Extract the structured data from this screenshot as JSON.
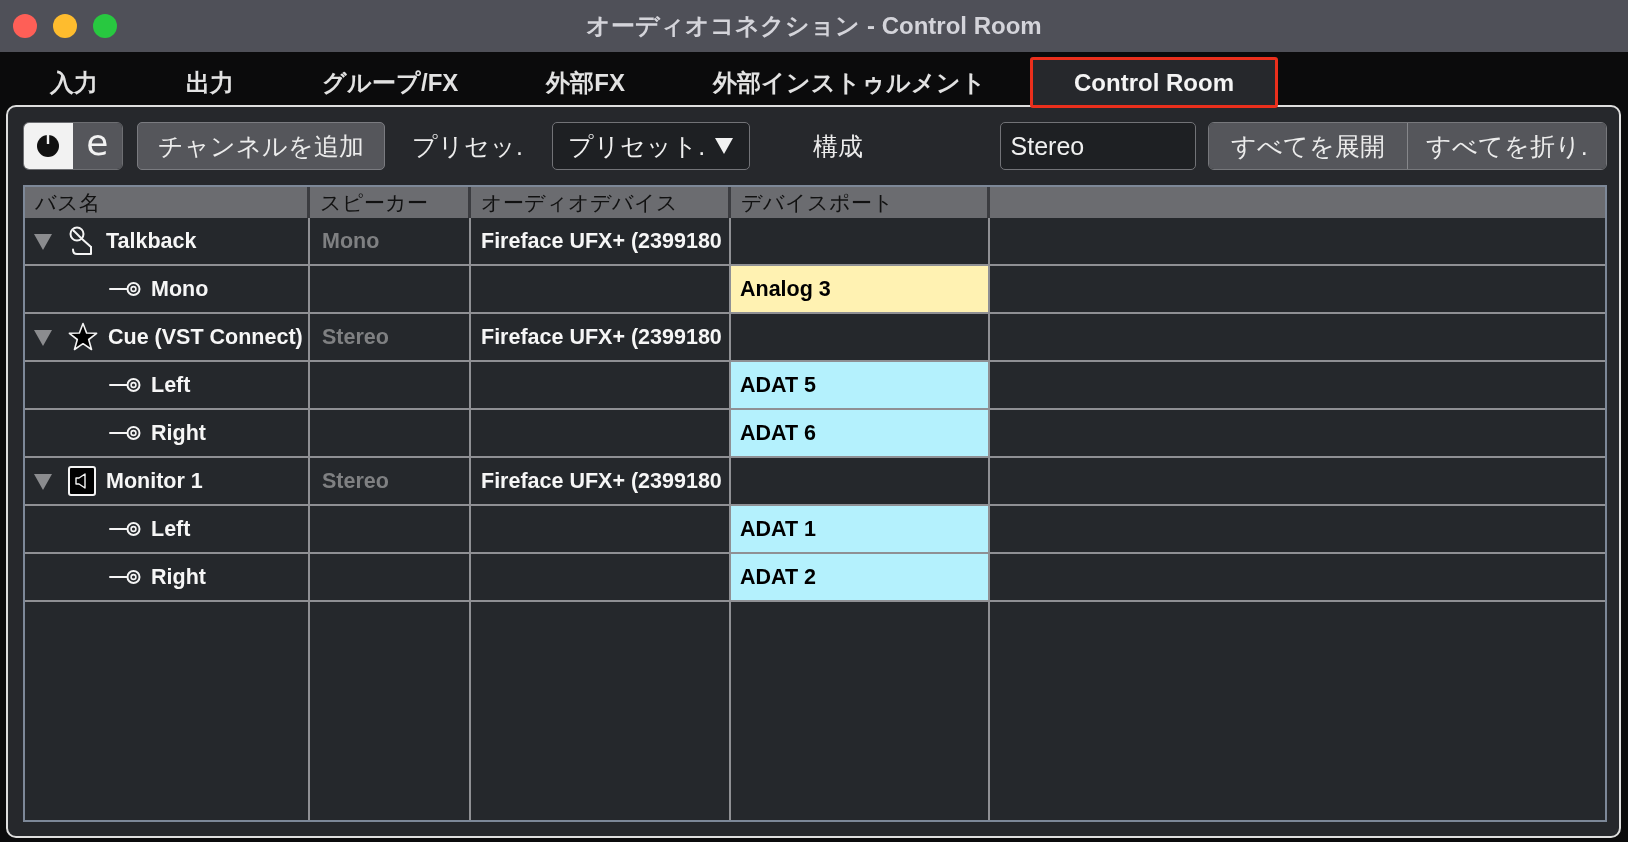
{
  "window": {
    "title": "オーディオコネクション - Control Room"
  },
  "tabs": [
    {
      "label": "入力",
      "selected": false,
      "highlighted": false
    },
    {
      "label": "出力",
      "selected": false,
      "highlighted": false
    },
    {
      "label": "グループ/FX",
      "selected": false,
      "highlighted": false
    },
    {
      "label": "外部FX",
      "selected": false,
      "highlighted": false
    },
    {
      "label": "外部インストゥルメント",
      "selected": false,
      "highlighted": false
    },
    {
      "label": "Control Room",
      "selected": true,
      "highlighted": true
    }
  ],
  "toolbar": {
    "toggles": [
      {
        "kind": "power",
        "on": true
      },
      {
        "kind": "edit",
        "label": "e",
        "on": false
      }
    ],
    "add_channel": "チャンネルを追加",
    "preset_label": "プリセッ.",
    "preset": "プリセット.",
    "config_label": "構成",
    "config": "Stereo",
    "expand_all": "すべてを展開",
    "collapse_all": "すべてを折り."
  },
  "table": {
    "columns": [
      "バス名",
      "スピーカー",
      "オーディオデバイス",
      "デバイスポート"
    ],
    "rows": [
      {
        "kind": "talkback",
        "name": "Talkback",
        "expanded": true,
        "speaker": "Mono",
        "device": "Fireface UFX+ (2399180",
        "children": [
          {
            "name": "Mono",
            "port": "Analog 3",
            "color": "#fff2b2"
          }
        ]
      },
      {
        "kind": "cue",
        "name": "Cue (VST Connect)",
        "expanded": true,
        "speaker": "Stereo",
        "device": "Fireface UFX+ (2399180",
        "children": [
          {
            "name": "Left",
            "port": "ADAT 5",
            "color": "#b4f1fd"
          },
          {
            "name": "Right",
            "port": "ADAT 6",
            "color": "#b4f1fd"
          }
        ]
      },
      {
        "kind": "monitor",
        "name": "Monitor 1",
        "expanded": true,
        "speaker": "Stereo",
        "device": "Fireface UFX+ (2399180",
        "children": [
          {
            "name": "Left",
            "port": "ADAT 1",
            "color": "#b4f1fd"
          },
          {
            "name": "Right",
            "port": "ADAT 2",
            "color": "#b4f1fd"
          }
        ]
      }
    ]
  }
}
